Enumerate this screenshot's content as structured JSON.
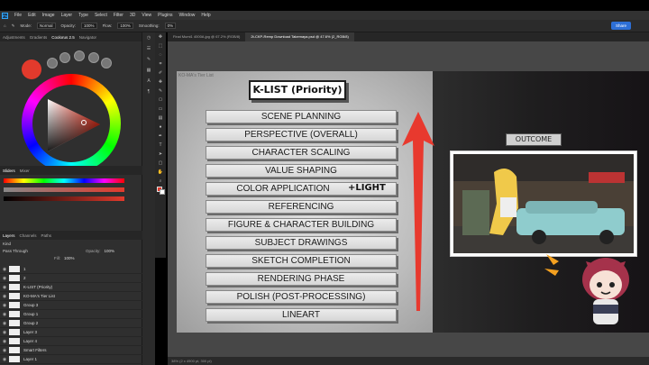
{
  "menubar": {
    "items": [
      "File",
      "Edit",
      "Image",
      "Layer",
      "Type",
      "Select",
      "Filter",
      "3D",
      "View",
      "Plugins",
      "Window",
      "Help"
    ]
  },
  "options_bar": {
    "mode_label": "Mode:",
    "mode_value": "Normal",
    "opacity_label": "Opacity:",
    "opacity_value": "100%",
    "flow_label": "Flow:",
    "flow_value": "100%",
    "smoothing_label": "Smoothing:",
    "smoothing_value": "0%",
    "share_label": "Share"
  },
  "left_panel": {
    "color_tabs": [
      "Adjustments",
      "Gradients",
      "Coolorus 2.5",
      "Navigator"
    ],
    "slider_tabs": [
      "Sliders",
      "Mixer"
    ],
    "layer_tabs": [
      "Layers",
      "Channels",
      "Paths"
    ],
    "blend_mode": "Pass Through",
    "opacity_label": "Opacity:",
    "opacity_value": "100%",
    "fill_label": "Fill:",
    "fill_value": "100%",
    "search_placeholder": "Kind",
    "layers": [
      {
        "name": "1"
      },
      {
        "name": "2"
      },
      {
        "name": "K-LIST (Priority)"
      },
      {
        "name": "KO-MA's Tier List"
      },
      {
        "name": "Group 3"
      },
      {
        "name": "Group 1"
      },
      {
        "name": "Group 2"
      },
      {
        "name": "Layer 3"
      },
      {
        "name": "Layer 4"
      },
      {
        "name": "Smart Filters"
      },
      {
        "name": "Layer 1"
      },
      {
        "name": "Background"
      }
    ]
  },
  "document": {
    "tabs": [
      "Final Mumi1 4000A.jpg @ 67.2% (RGB/8)",
      "2t-CKP-Remp Download Takemaya.psd @ 47.6% (2_RGB/8)"
    ],
    "title_label": "KO-MA's Tier List",
    "klist_title": "K-LIST (Priority)",
    "items": [
      "SCENE PLANNING",
      "PERSPECTIVE (OVERALL)",
      "CHARACTER SCALING",
      "VALUE SHAPING",
      "COLOR APPLICATION",
      "REFERENCING",
      "FIGURE & CHARACTER BUILDING",
      "SUBJECT DRAWINGS",
      "SKETCH COMPLETION",
      "RENDERING PHASE",
      "POLISH (POST-PROCESSING)",
      "LINEART"
    ],
    "light_tag": "+LIGHT",
    "outcome_label": "OUTCOME"
  },
  "status": {
    "zoom": "38% (2 x 4900 pt, 300 pi)"
  },
  "colors": {
    "foreground": "#e23a2c",
    "arrow": "#e8392e",
    "accent": "#2d6fd6"
  }
}
